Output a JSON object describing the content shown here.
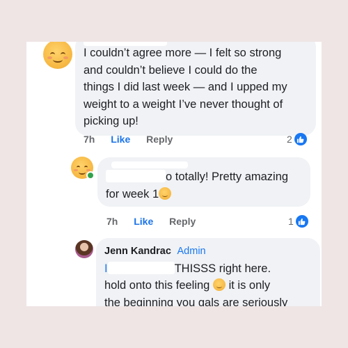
{
  "comments": [
    {
      "text_lines": [
        "I couldn’t agree more — I felt so strong",
        "and couldn’t believe I could do the",
        "things I did last week — and I upped my",
        "weight to a weight I’ve never thought of",
        "picking up!"
      ],
      "time": "7h",
      "like_label": "Like",
      "reply_label": "Reply",
      "reaction_count": "2",
      "reaction_icon": "thumbs-up-icon",
      "avatar_icon": "smiling-face-icon"
    },
    {
      "text_line1_visible": "o totally! Pretty amazing",
      "text_line2": "for week 1",
      "text_line2_emoji": "star-struck-emoji",
      "time": "7h",
      "like_label": "Like",
      "reply_label": "Reply",
      "reaction_count": "1",
      "reaction_icon": "thumbs-up-icon",
      "avatar_icon": "smiling-face-icon"
    },
    {
      "author": "Jenn Kandrac",
      "badge": "Admin",
      "text_line1_visible": "THISSS right here.",
      "text_line2": "hold onto this feeling",
      "text_line2_after": "it is only",
      "text_line3": "the beginning you gals are seriously",
      "inline_emoji": "slightly-smiling-face-icon"
    }
  ],
  "colors": {
    "background": "#efe5e5",
    "bubble": "#f0f2f5",
    "link_blue": "#1a73e8",
    "reaction_blue": "#1877f2"
  }
}
